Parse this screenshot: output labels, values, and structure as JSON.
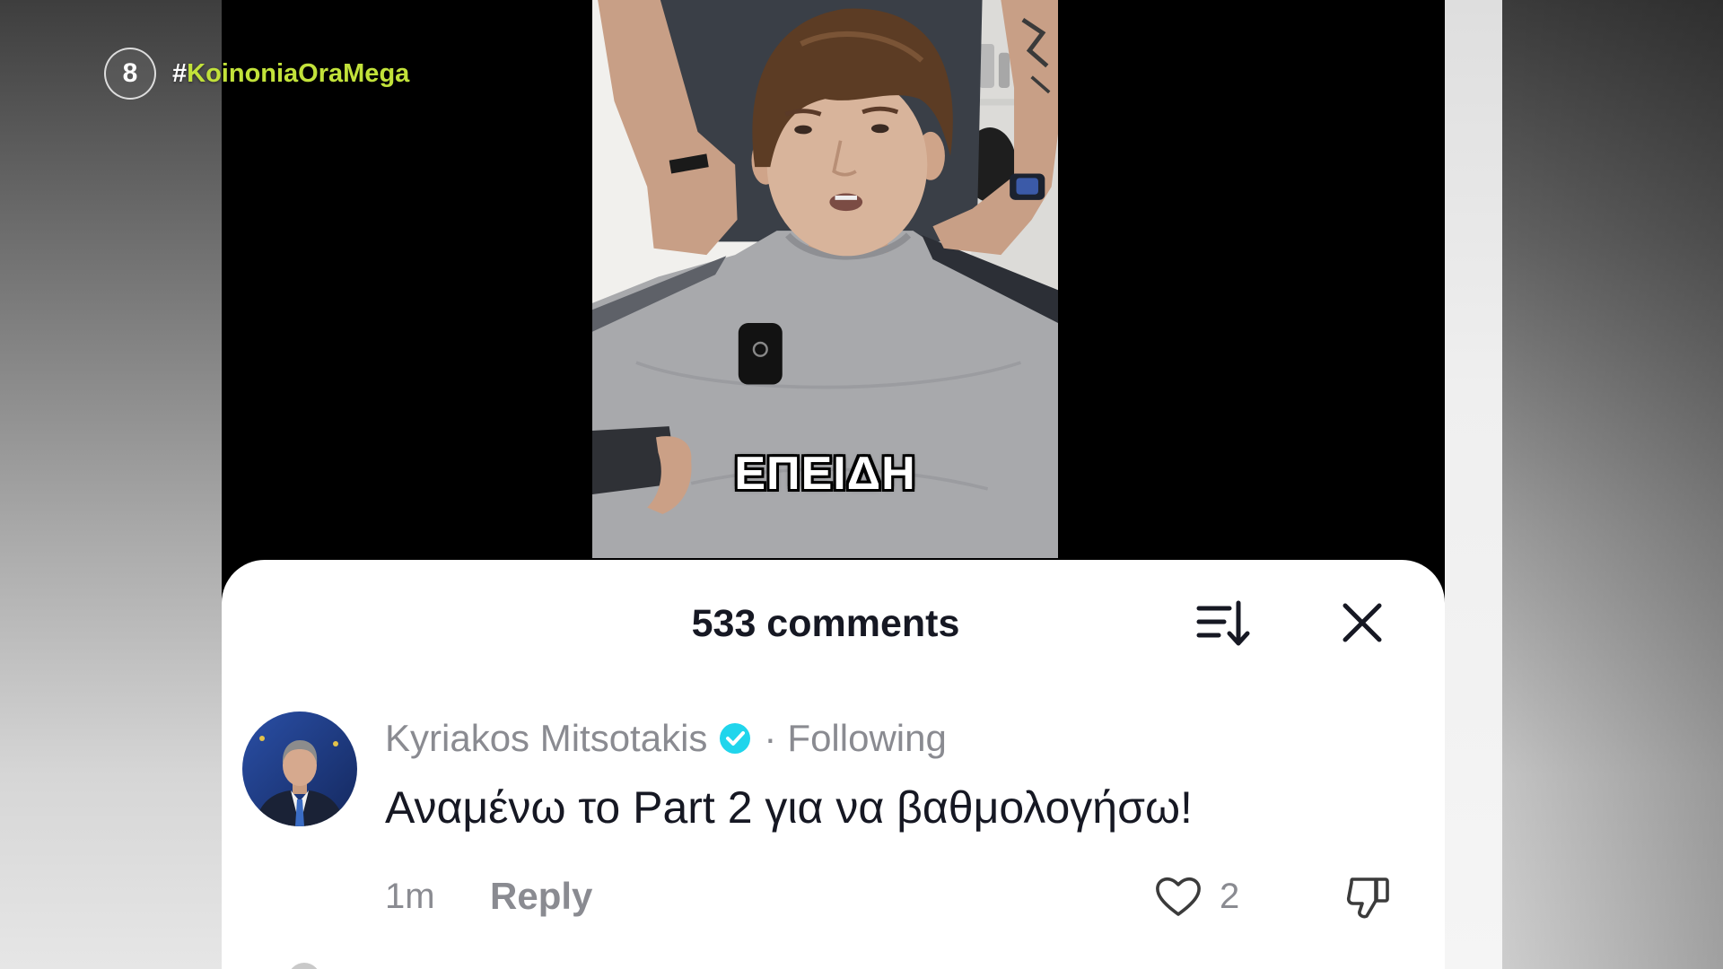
{
  "channel": {
    "logo_number": "8",
    "hashtag_symbol": "#",
    "hashtag_name": "KoinoniaOraMega"
  },
  "video": {
    "subtitle": "ΕΠΕΙΔΗ"
  },
  "comments_panel": {
    "count_label": "533 comments",
    "sort_icon": "sort-icon",
    "close_icon": "close-icon"
  },
  "comments": [
    {
      "author": "Kyriakos Mitsotakis",
      "verified": true,
      "verified_icon": "verified-badge-icon",
      "separator": "·",
      "relation": "Following",
      "text": "Αναμένω το Part 2 για να βαθμολογήσω!",
      "time": "1m",
      "reply_label": "Reply",
      "like_icon": "heart-icon",
      "like_count": "2",
      "dislike_icon": "thumbs-down-icon",
      "avatar_icon": "user-avatar"
    }
  ],
  "colors": {
    "hashtag_accent": "#c2e23a",
    "verified_badge": "#20d5ec",
    "text_primary": "#161823",
    "text_secondary": "#8a8b91"
  }
}
